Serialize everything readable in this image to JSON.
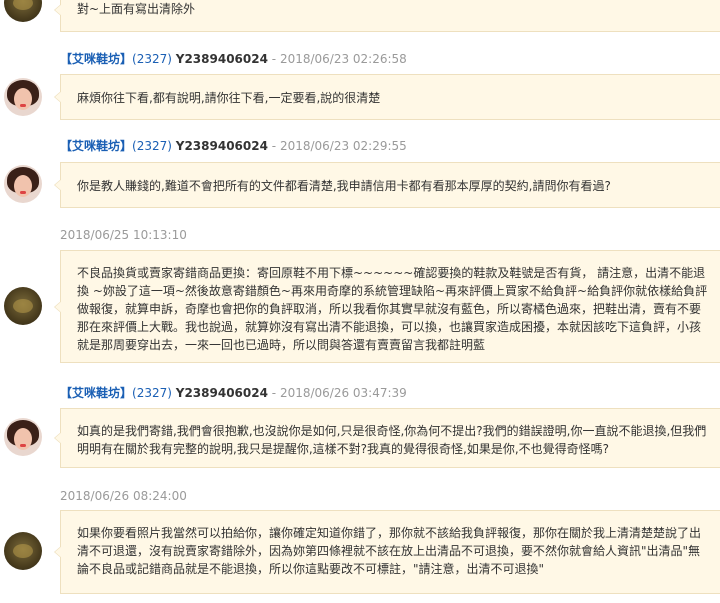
{
  "messages": [
    {
      "kind": "shop",
      "text": "對~上面有寫出清除外"
    },
    {
      "kind": "buyer",
      "name": "【艾咪鞋坊】",
      "uid": "(2327)",
      "account": "Y2389406024",
      "sep": "-",
      "time": "2018/06/23 02:26:58",
      "text": "麻煩你往下看,都有說明,請你往下看,一定要看,說的很清楚"
    },
    {
      "kind": "buyer",
      "name": "【艾咪鞋坊】",
      "uid": "(2327)",
      "account": "Y2389406024",
      "sep": "-",
      "time": "2018/06/23 02:29:55",
      "text": "你是教人賺錢的,難道不會把所有的文件都看清楚,我申請信用卡都有看那本厚厚的契約,請問你有看過?"
    },
    {
      "kind": "shop",
      "time": "2018/06/25 10:13:10",
      "text": "不良品換貨或賣家寄錯商品更換：寄回原鞋不用下標~~~~~~確認要換的鞋款及鞋號是否有貨， 請注意，出清不能退換 ~妳設了這一項~然後故意寄錯顏色~再來用奇摩的系統管理缺陷~再來評價上買家不給負評~給負評你就依樣給負評做報復，就算申訴，奇摩也會把你的負評取消，所以我看你其實早就沒有藍色，所以寄橘色過來，把鞋出清，賣有不要那在來評價上大戰。我也說過，就算妳沒有寫出清不能退換，可以換，也讓買家造成困擾，本就因該吃下這負評，小孩就是那周要穿出去，一來一回也已過時，所以問與答還有賣賣留言我都註明藍"
    },
    {
      "kind": "buyer",
      "name": "【艾咪鞋坊】",
      "uid": "(2327)",
      "account": "Y2389406024",
      "sep": "-",
      "time": "2018/06/26 03:47:39",
      "text": "如真的是我們寄錯,我們會很抱歉,也沒說你是如何,只是很奇怪,你為何不提出?我們的錯誤證明,你一直說不能退換,但我們明明有在關於我有完整的說明,我只是提醒你,這樣不對?我真的覺得很奇怪,如果是你,不也覺得奇怪嗎?"
    },
    {
      "kind": "shop",
      "time": "2018/06/26 08:24:00",
      "text": "如果你要看照片我當然可以拍給你，讓你確定知道你錯了，那你就不該給我負評報復，那你在關於我上清清楚楚說了出清不可退還，沒有說賣家寄錯除外，因為妳第四條裡就不該在放上出清品不可退換，要不然你就會給人資訊\"出清品\"無論不良品或記錯商品就是不能退換，所以你這點要改不可標註，\"請注意，出清不可退換\""
    }
  ]
}
